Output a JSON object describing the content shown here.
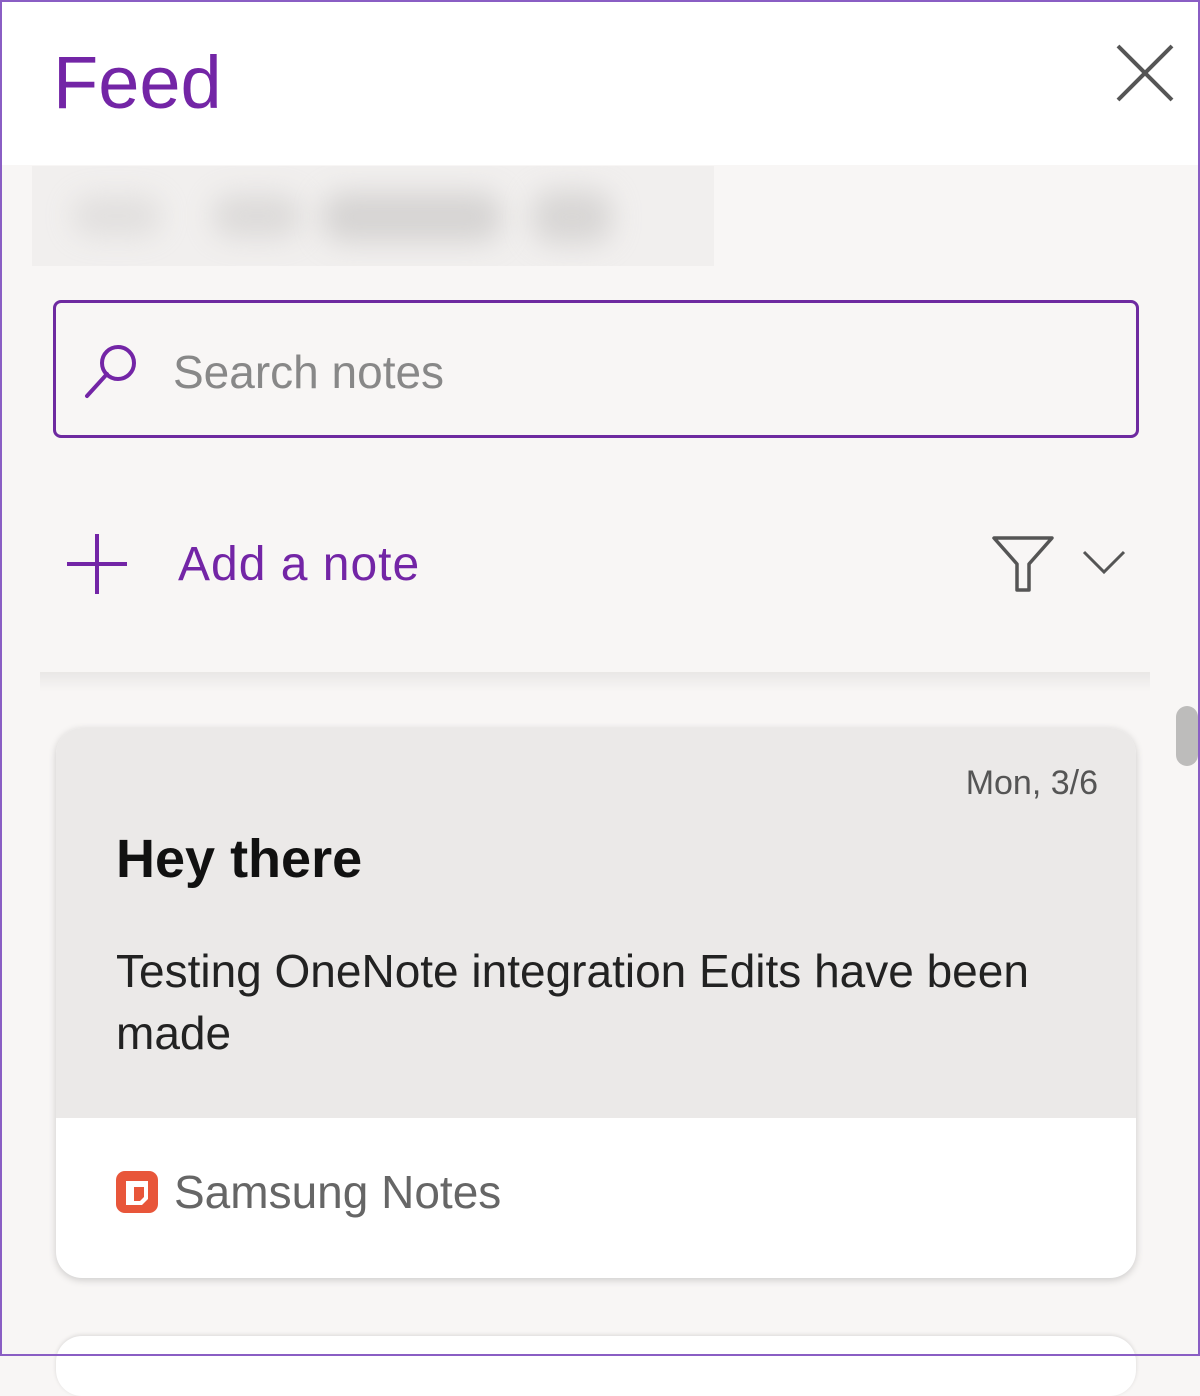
{
  "header": {
    "title": "Feed",
    "close_icon": "close-icon"
  },
  "search": {
    "placeholder": "Search notes",
    "value": "",
    "icon": "search-icon"
  },
  "actions": {
    "add_note_label": "Add a note",
    "add_icon": "plus-icon",
    "filter_icon": "filter-icon",
    "dropdown_icon": "chevron-down-icon"
  },
  "notes": [
    {
      "date": "Mon, 3/6",
      "title": "Hey there",
      "body": "Testing OneNote integration Edits have been made",
      "source": "Samsung Notes",
      "source_icon": "samsung-notes-icon"
    }
  ],
  "colors": {
    "accent": "#7325a6",
    "search_border": "#6e2aa0",
    "background": "#f8f6f5",
    "card_top": "#ebe9e8",
    "samsung_notes": "#e8563a"
  }
}
